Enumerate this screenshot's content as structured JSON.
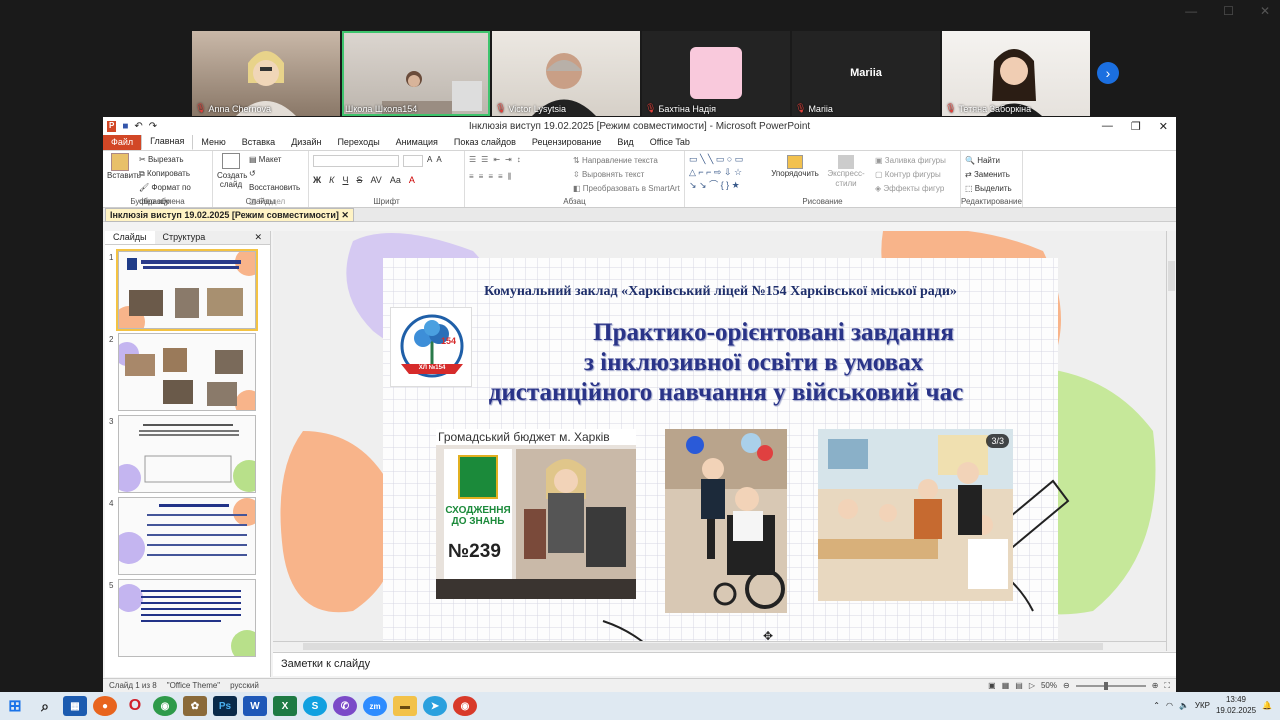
{
  "participants": [
    {
      "name": "Anna Chernova",
      "muted": true
    },
    {
      "name": "Школа Школа154",
      "muted": false,
      "active": true
    },
    {
      "name": "Victor Lysytsia",
      "muted": true
    },
    {
      "name": "Бахтіна Надія",
      "muted": true
    },
    {
      "name": "Mariia",
      "muted": true,
      "display_name": "Mariia"
    },
    {
      "name": "Тетяна Заборкіна",
      "muted": true
    }
  ],
  "ppt": {
    "title": "Інклюзія виступ 19.02.2025 [Режим совместимости] - Microsoft PowerPoint",
    "tabs": [
      "Файл",
      "Главная",
      "Меню",
      "Вставка",
      "Дизайн",
      "Переходы",
      "Анимация",
      "Показ слайдов",
      "Рецензирование",
      "Вид",
      "Office Tab"
    ],
    "ribbon": {
      "clipboard": {
        "label": "Буфер обмена",
        "paste": "Вставить",
        "cut": "Вырезать",
        "copy": "Копировать",
        "format": "Формат по образцу"
      },
      "slides": {
        "label": "Слайды",
        "create": "Создать слайд",
        "layout": "Макет",
        "reset": "Восстановить",
        "section": "Раздел"
      },
      "font": {
        "label": "Шрифт"
      },
      "paragraph": {
        "label": "Абзац",
        "direction": "Направление текста",
        "align": "Выровнять текст",
        "smartart": "Преобразовать в SmartArt"
      },
      "drawing": {
        "label": "Рисование",
        "arrange": "Упорядочить",
        "styles": "Экспресс-стили",
        "fill": "Заливка фигуры",
        "outline": "Контур фигуры",
        "effects": "Эффекты фигур"
      },
      "editing": {
        "label": "Редактирование",
        "find": "Найти",
        "replace": "Заменить",
        "select": "Выделить"
      }
    },
    "doc_tab": "Інклюзія виступ 19.02.2025 [Режим совместимости]",
    "panel_tabs": [
      "Слайды",
      "Структура"
    ],
    "slide_numbers": [
      "1",
      "2",
      "3",
      "4",
      "5"
    ],
    "slide": {
      "org": "Комунальний заклад «Харківський ліцей №154 Харківської міської ради»",
      "title_lines": [
        "Практико-орієнтовані завдання",
        "з інклюзивної освіти в умовах",
        "дистанційного навчання у військовий час"
      ],
      "logo_text": "154",
      "logo_caption": "ХЛ №154",
      "photo1_caption": "Громадський бюджет м. Харків",
      "badge_text": "СХОДЖЕННЯ ДО ЗНАНЬ",
      "badge_number": "№239",
      "counter": "3/3"
    },
    "notes": "Заметки к слайду",
    "status": {
      "slide": "Слайд 1 из 8",
      "theme": "\"Office Theme\"",
      "lang": "русский",
      "zoom": "50%"
    }
  },
  "clock": {
    "time": "13:49",
    "date": "19.02.2025",
    "lang": "УКР"
  }
}
